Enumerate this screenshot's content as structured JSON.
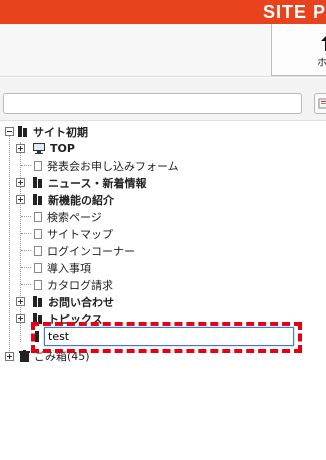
{
  "header": {
    "brand": "SITE P",
    "home_label": "ホ"
  },
  "search": {
    "value": ""
  },
  "tree": {
    "root": "サイト初期",
    "items": [
      {
        "label": "TOP",
        "bold": true
      },
      {
        "label": "発表会お申し込みフォーム",
        "bold": false
      },
      {
        "label": "ニュース・新着情報",
        "bold": true
      },
      {
        "label": "新機能の紹介",
        "bold": true
      },
      {
        "label": "検索ページ",
        "bold": false
      },
      {
        "label": "サイトマップ",
        "bold": false
      },
      {
        "label": "ログインコーナー",
        "bold": false
      },
      {
        "label": "導入事項",
        "bold": false
      },
      {
        "label": "カタログ請求",
        "bold": false
      },
      {
        "label": "お問い合わせ",
        "bold": true
      },
      {
        "label": "トピックス",
        "bold": true
      }
    ],
    "new_item_value": "test",
    "trash_label": "ごみ箱(45)"
  },
  "colors": {
    "brand_red": "#e8431c",
    "highlight_red": "#e60012",
    "focus_blue": "#3d7bd8"
  }
}
